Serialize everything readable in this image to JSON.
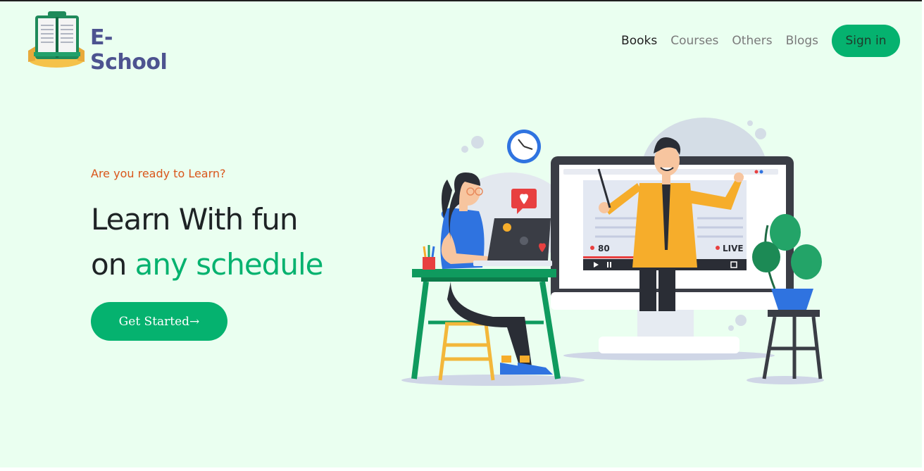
{
  "brand": {
    "name": "E- School",
    "logo_icon": "open-book-icon"
  },
  "nav": {
    "links": [
      {
        "label": "Books",
        "active": true
      },
      {
        "label": "Courses",
        "active": false
      },
      {
        "label": "Others",
        "active": false
      },
      {
        "label": "Blogs",
        "active": false
      }
    ],
    "signin_label": "Sign in"
  },
  "hero": {
    "eyebrow": "Are you ready to Learn?",
    "headline_line1": "Learn With fun",
    "headline_prefix": "on ",
    "headline_accent": "any schedule",
    "cta_label": "Get Started→"
  },
  "illustration": {
    "viewer_count": "80",
    "live_label": "LIVE"
  },
  "colors": {
    "background": "#eafff0",
    "accent": "#05b26f",
    "eyebrow": "#d9561b",
    "brand_text": "#4d5390",
    "heading": "#1e2325"
  }
}
